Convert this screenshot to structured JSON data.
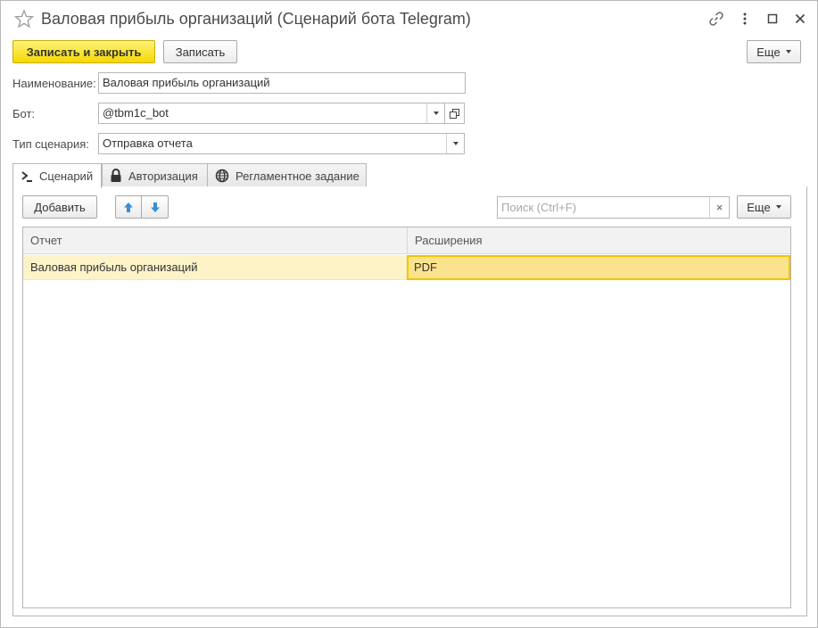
{
  "window": {
    "title": "Валовая прибыль организаций (Сценарий бота Telegram)"
  },
  "toolbar": {
    "save_close_label": "Записать и закрыть",
    "save_label": "Записать",
    "more_label": "Еще"
  },
  "form": {
    "name_label": "Наименование:",
    "name_value": "Валовая прибыль организаций",
    "bot_label": "Бот:",
    "bot_value": "@tbm1c_bot",
    "scenario_type_label": "Тип сценария:",
    "scenario_type_value": "Отправка отчета"
  },
  "tabs": [
    {
      "label": "Сценарий",
      "icon": "terminal-icon",
      "active": true
    },
    {
      "label": "Авторизация",
      "icon": "lock-icon",
      "active": false
    },
    {
      "label": "Регламентное задание",
      "icon": "globe-icon",
      "active": false
    }
  ],
  "scenario": {
    "add_label": "Добавить",
    "search_placeholder": "Поиск (Ctrl+F)",
    "search_clear": "×",
    "more_label": "Еще",
    "columns": [
      "Отчет",
      "Расширения"
    ],
    "rows": [
      {
        "report": "Валовая прибыль организаций",
        "extension": "PDF"
      }
    ]
  },
  "colors": {
    "accent_yellow": "#f5d800",
    "row_highlight": "#fdf3c8",
    "cell_selected": "#fbe38e",
    "arrow_blue": "#3a8ed6"
  }
}
